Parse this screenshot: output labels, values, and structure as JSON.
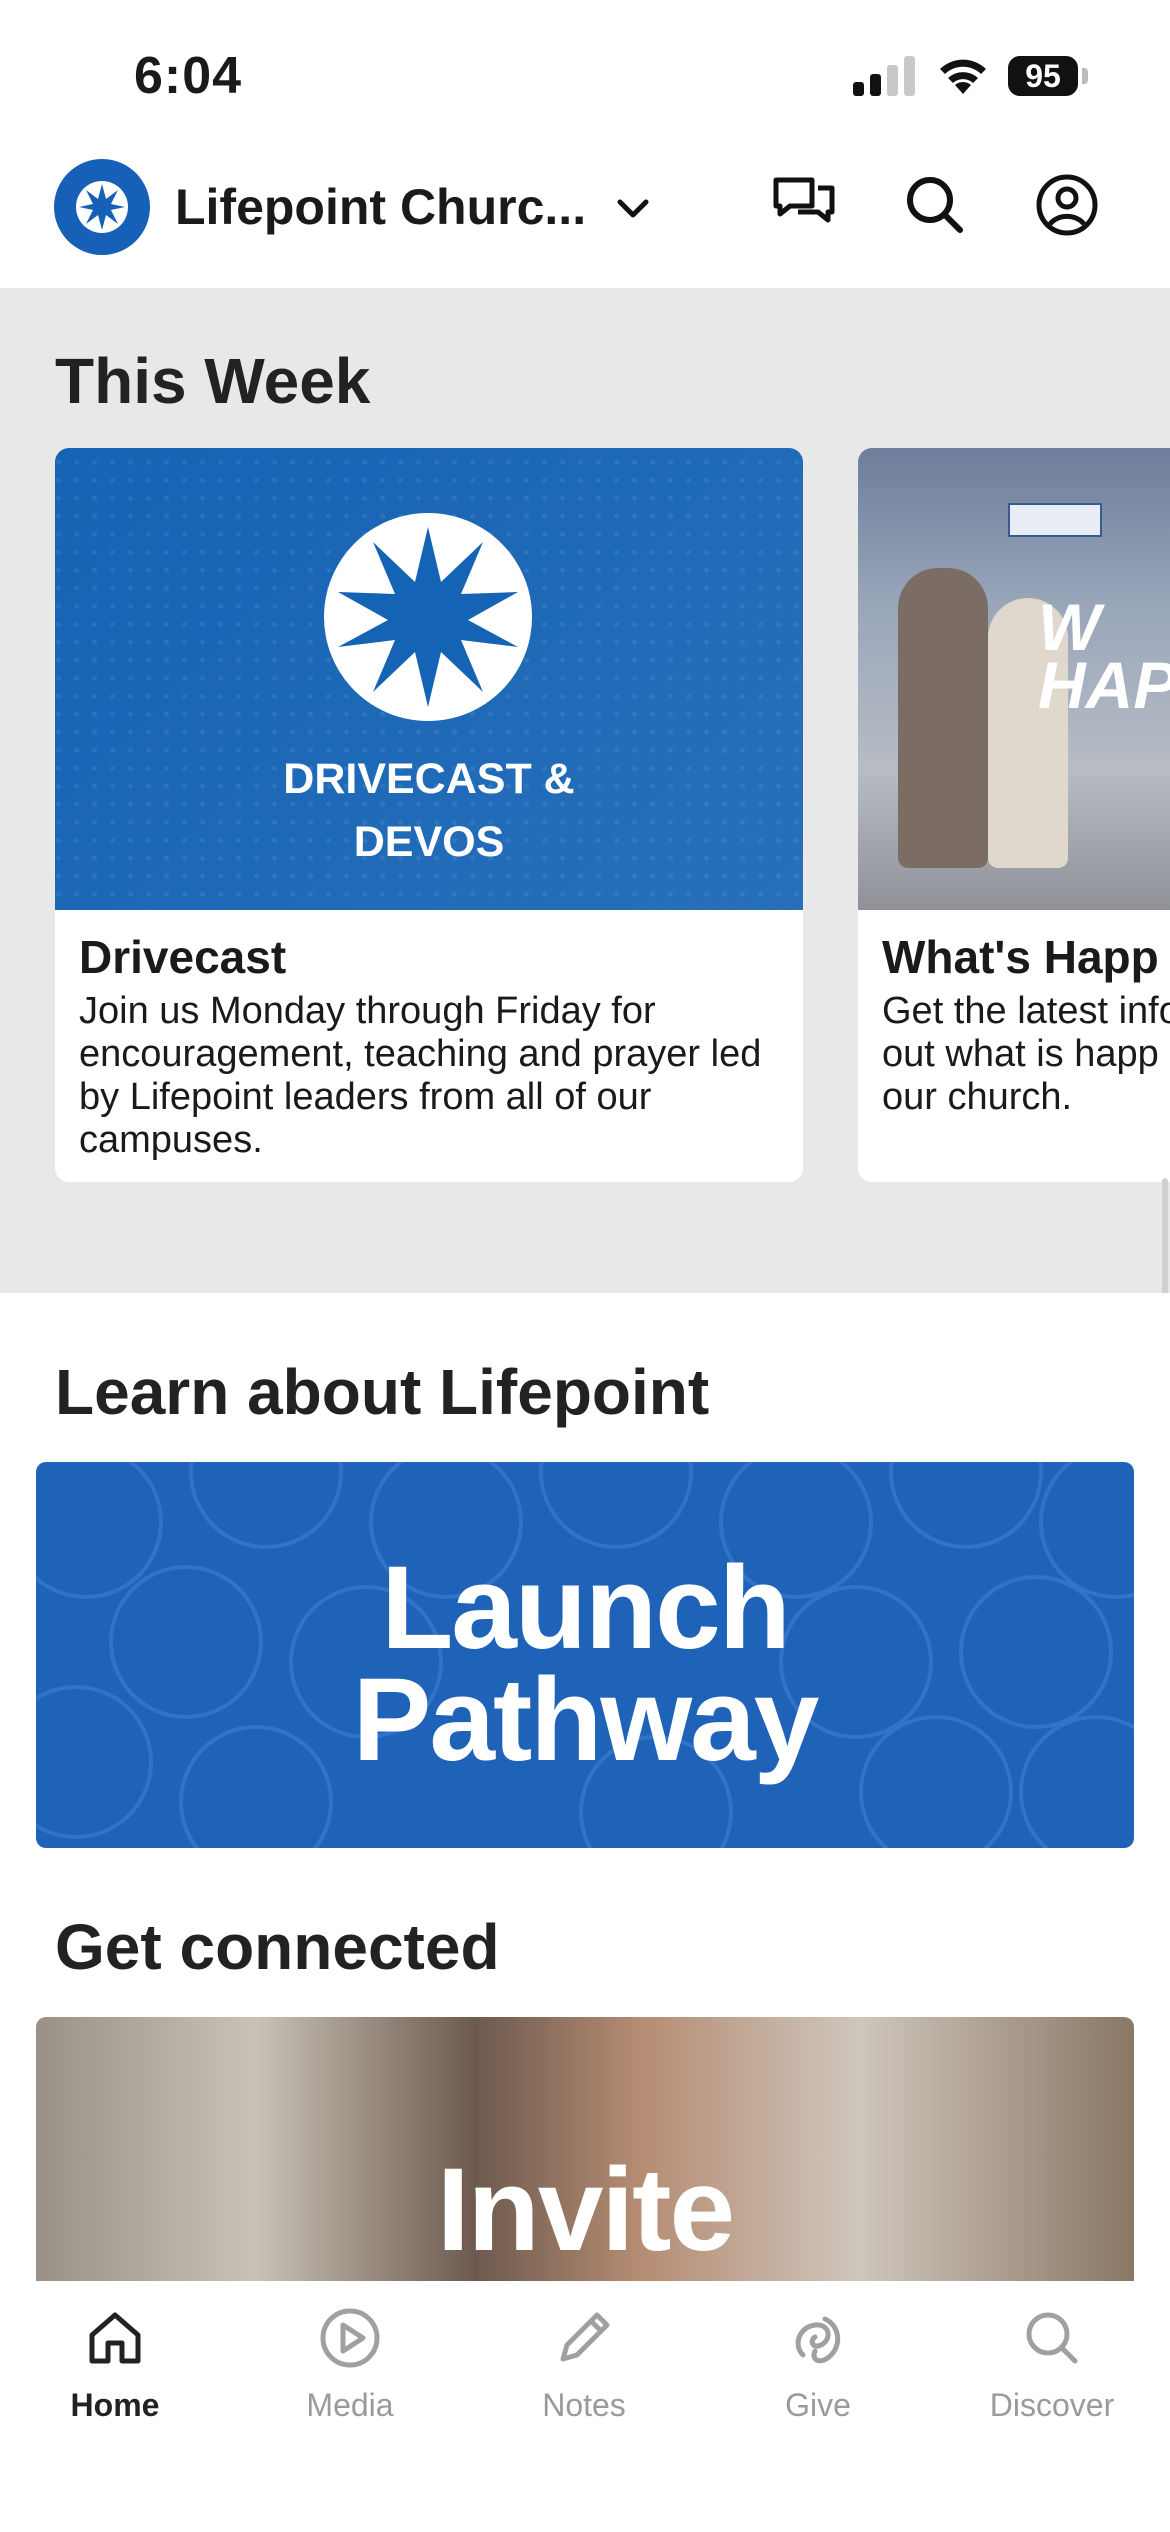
{
  "status_bar": {
    "time": "6:04",
    "battery": "95"
  },
  "header": {
    "church_name": "Lifepoint Churc...",
    "icons": [
      "chevron-down-icon",
      "chat-icon",
      "search-icon",
      "account-icon"
    ]
  },
  "this_week": {
    "title": "This Week",
    "cards": [
      {
        "image_text": "DRIVECAST &\nDEVOS",
        "title": "Drivecast",
        "body": "Join us Monday through Friday for encouragement, teaching and prayer led by Lifepoint leaders from all of our campuses."
      },
      {
        "image_text": "W\nHAP",
        "title": "What's Happ",
        "body": "Get the latest info out what is happ our church."
      }
    ]
  },
  "learn": {
    "title": "Learn about Lifepoint",
    "banner_text": "Launch\nPathway"
  },
  "connected": {
    "title": "Get connected",
    "banner_text": "Invite"
  },
  "bottom_nav": {
    "items": [
      {
        "label": "Home",
        "icon": "home-icon",
        "active": true
      },
      {
        "label": "Media",
        "icon": "play-icon",
        "active": false
      },
      {
        "label": "Notes",
        "icon": "pencil-icon",
        "active": false
      },
      {
        "label": "Give",
        "icon": "give-icon",
        "active": false
      },
      {
        "label": "Discover",
        "icon": "search-icon",
        "active": false
      }
    ]
  },
  "colors": {
    "brand_blue": "#1760B8",
    "section_bg": "#e8e8e8"
  }
}
